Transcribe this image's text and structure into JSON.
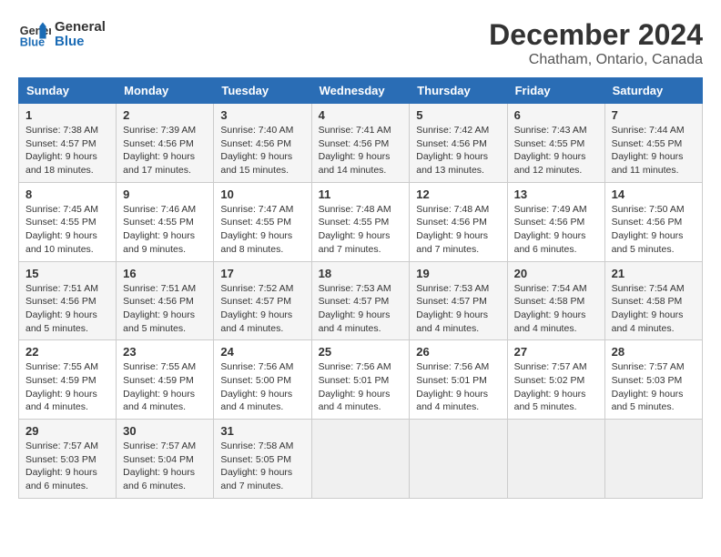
{
  "logo": {
    "line1": "General",
    "line2": "Blue"
  },
  "title": "December 2024",
  "location": "Chatham, Ontario, Canada",
  "days_of_week": [
    "Sunday",
    "Monday",
    "Tuesday",
    "Wednesday",
    "Thursday",
    "Friday",
    "Saturday"
  ],
  "weeks": [
    [
      {
        "day": "1",
        "sunrise": "7:38 AM",
        "sunset": "4:57 PM",
        "daylight_hours": "9",
        "daylight_minutes": "18"
      },
      {
        "day": "2",
        "sunrise": "7:39 AM",
        "sunset": "4:56 PM",
        "daylight_hours": "9",
        "daylight_minutes": "17"
      },
      {
        "day": "3",
        "sunrise": "7:40 AM",
        "sunset": "4:56 PM",
        "daylight_hours": "9",
        "daylight_minutes": "15"
      },
      {
        "day": "4",
        "sunrise": "7:41 AM",
        "sunset": "4:56 PM",
        "daylight_hours": "9",
        "daylight_minutes": "14"
      },
      {
        "day": "5",
        "sunrise": "7:42 AM",
        "sunset": "4:56 PM",
        "daylight_hours": "9",
        "daylight_minutes": "13"
      },
      {
        "day": "6",
        "sunrise": "7:43 AM",
        "sunset": "4:55 PM",
        "daylight_hours": "9",
        "daylight_minutes": "12"
      },
      {
        "day": "7",
        "sunrise": "7:44 AM",
        "sunset": "4:55 PM",
        "daylight_hours": "9",
        "daylight_minutes": "11"
      }
    ],
    [
      {
        "day": "8",
        "sunrise": "7:45 AM",
        "sunset": "4:55 PM",
        "daylight_hours": "9",
        "daylight_minutes": "10"
      },
      {
        "day": "9",
        "sunrise": "7:46 AM",
        "sunset": "4:55 PM",
        "daylight_hours": "9",
        "daylight_minutes": "9"
      },
      {
        "day": "10",
        "sunrise": "7:47 AM",
        "sunset": "4:55 PM",
        "daylight_hours": "9",
        "daylight_minutes": "8"
      },
      {
        "day": "11",
        "sunrise": "7:48 AM",
        "sunset": "4:55 PM",
        "daylight_hours": "9",
        "daylight_minutes": "7"
      },
      {
        "day": "12",
        "sunrise": "7:48 AM",
        "sunset": "4:56 PM",
        "daylight_hours": "9",
        "daylight_minutes": "7"
      },
      {
        "day": "13",
        "sunrise": "7:49 AM",
        "sunset": "4:56 PM",
        "daylight_hours": "9",
        "daylight_minutes": "6"
      },
      {
        "day": "14",
        "sunrise": "7:50 AM",
        "sunset": "4:56 PM",
        "daylight_hours": "9",
        "daylight_minutes": "5"
      }
    ],
    [
      {
        "day": "15",
        "sunrise": "7:51 AM",
        "sunset": "4:56 PM",
        "daylight_hours": "9",
        "daylight_minutes": "5"
      },
      {
        "day": "16",
        "sunrise": "7:51 AM",
        "sunset": "4:56 PM",
        "daylight_hours": "9",
        "daylight_minutes": "5"
      },
      {
        "day": "17",
        "sunrise": "7:52 AM",
        "sunset": "4:57 PM",
        "daylight_hours": "9",
        "daylight_minutes": "4"
      },
      {
        "day": "18",
        "sunrise": "7:53 AM",
        "sunset": "4:57 PM",
        "daylight_hours": "9",
        "daylight_minutes": "4"
      },
      {
        "day": "19",
        "sunrise": "7:53 AM",
        "sunset": "4:57 PM",
        "daylight_hours": "9",
        "daylight_minutes": "4"
      },
      {
        "day": "20",
        "sunrise": "7:54 AM",
        "sunset": "4:58 PM",
        "daylight_hours": "9",
        "daylight_minutes": "4"
      },
      {
        "day": "21",
        "sunrise": "7:54 AM",
        "sunset": "4:58 PM",
        "daylight_hours": "9",
        "daylight_minutes": "4"
      }
    ],
    [
      {
        "day": "22",
        "sunrise": "7:55 AM",
        "sunset": "4:59 PM",
        "daylight_hours": "9",
        "daylight_minutes": "4"
      },
      {
        "day": "23",
        "sunrise": "7:55 AM",
        "sunset": "4:59 PM",
        "daylight_hours": "9",
        "daylight_minutes": "4"
      },
      {
        "day": "24",
        "sunrise": "7:56 AM",
        "sunset": "5:00 PM",
        "daylight_hours": "9",
        "daylight_minutes": "4"
      },
      {
        "day": "25",
        "sunrise": "7:56 AM",
        "sunset": "5:01 PM",
        "daylight_hours": "9",
        "daylight_minutes": "4"
      },
      {
        "day": "26",
        "sunrise": "7:56 AM",
        "sunset": "5:01 PM",
        "daylight_hours": "9",
        "daylight_minutes": "4"
      },
      {
        "day": "27",
        "sunrise": "7:57 AM",
        "sunset": "5:02 PM",
        "daylight_hours": "9",
        "daylight_minutes": "5"
      },
      {
        "day": "28",
        "sunrise": "7:57 AM",
        "sunset": "5:03 PM",
        "daylight_hours": "9",
        "daylight_minutes": "5"
      }
    ],
    [
      {
        "day": "29",
        "sunrise": "7:57 AM",
        "sunset": "5:03 PM",
        "daylight_hours": "9",
        "daylight_minutes": "6"
      },
      {
        "day": "30",
        "sunrise": "7:57 AM",
        "sunset": "5:04 PM",
        "daylight_hours": "9",
        "daylight_minutes": "6"
      },
      {
        "day": "31",
        "sunrise": "7:58 AM",
        "sunset": "5:05 PM",
        "daylight_hours": "9",
        "daylight_minutes": "7"
      },
      null,
      null,
      null,
      null
    ]
  ],
  "labels": {
    "sunrise": "Sunrise:",
    "sunset": "Sunset:",
    "daylight": "Daylight:",
    "hours": "hours",
    "and": "and",
    "minutes": "minutes."
  }
}
